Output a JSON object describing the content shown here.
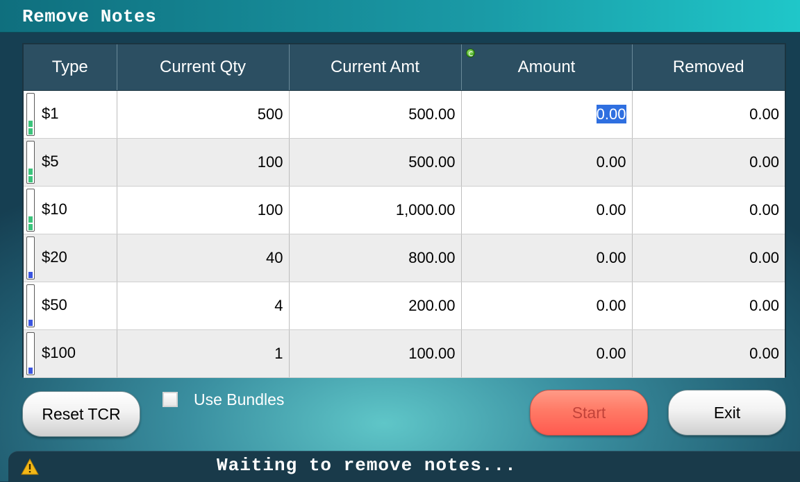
{
  "window": {
    "title": "Remove Notes"
  },
  "table": {
    "headers": [
      "Type",
      "Current Qty",
      "Current Amt",
      "Amount",
      "Removed"
    ],
    "rows": [
      {
        "type": "$1",
        "current_qty": "500",
        "current_amt": "500.00",
        "amount": "0.00",
        "removed": "0.00",
        "level_color": "#3cc47c",
        "level_segments": 2
      },
      {
        "type": "$5",
        "current_qty": "100",
        "current_amt": "500.00",
        "amount": "0.00",
        "removed": "0.00",
        "level_color": "#3cc47c",
        "level_segments": 2
      },
      {
        "type": "$10",
        "current_qty": "100",
        "current_amt": "1,000.00",
        "amount": "0.00",
        "removed": "0.00",
        "level_color": "#3cc47c",
        "level_segments": 2
      },
      {
        "type": "$20",
        "current_qty": "40",
        "current_amt": "800.00",
        "amount": "0.00",
        "removed": "0.00",
        "level_color": "#3b55e0",
        "level_segments": 1
      },
      {
        "type": "$50",
        "current_qty": "4",
        "current_amt": "200.00",
        "amount": "0.00",
        "removed": "0.00",
        "level_color": "#3b55e0",
        "level_segments": 1
      },
      {
        "type": "$100",
        "current_qty": "1",
        "current_amt": "100.00",
        "amount": "0.00",
        "removed": "0.00",
        "level_color": "#3b55e0",
        "level_segments": 1
      }
    ]
  },
  "controls": {
    "reset_label": "Reset TCR",
    "use_bundles_label": "Use Bundles",
    "use_bundles_checked": false,
    "start_label": "Start",
    "exit_label": "Exit"
  },
  "status": {
    "icon": "warning-icon",
    "text": "Waiting to remove notes..."
  },
  "colors": {
    "accent": "#1fc7c9",
    "header_bg": "#2c4f62",
    "start_bg": "#ff7a66",
    "selection": "#2f6fe0"
  }
}
